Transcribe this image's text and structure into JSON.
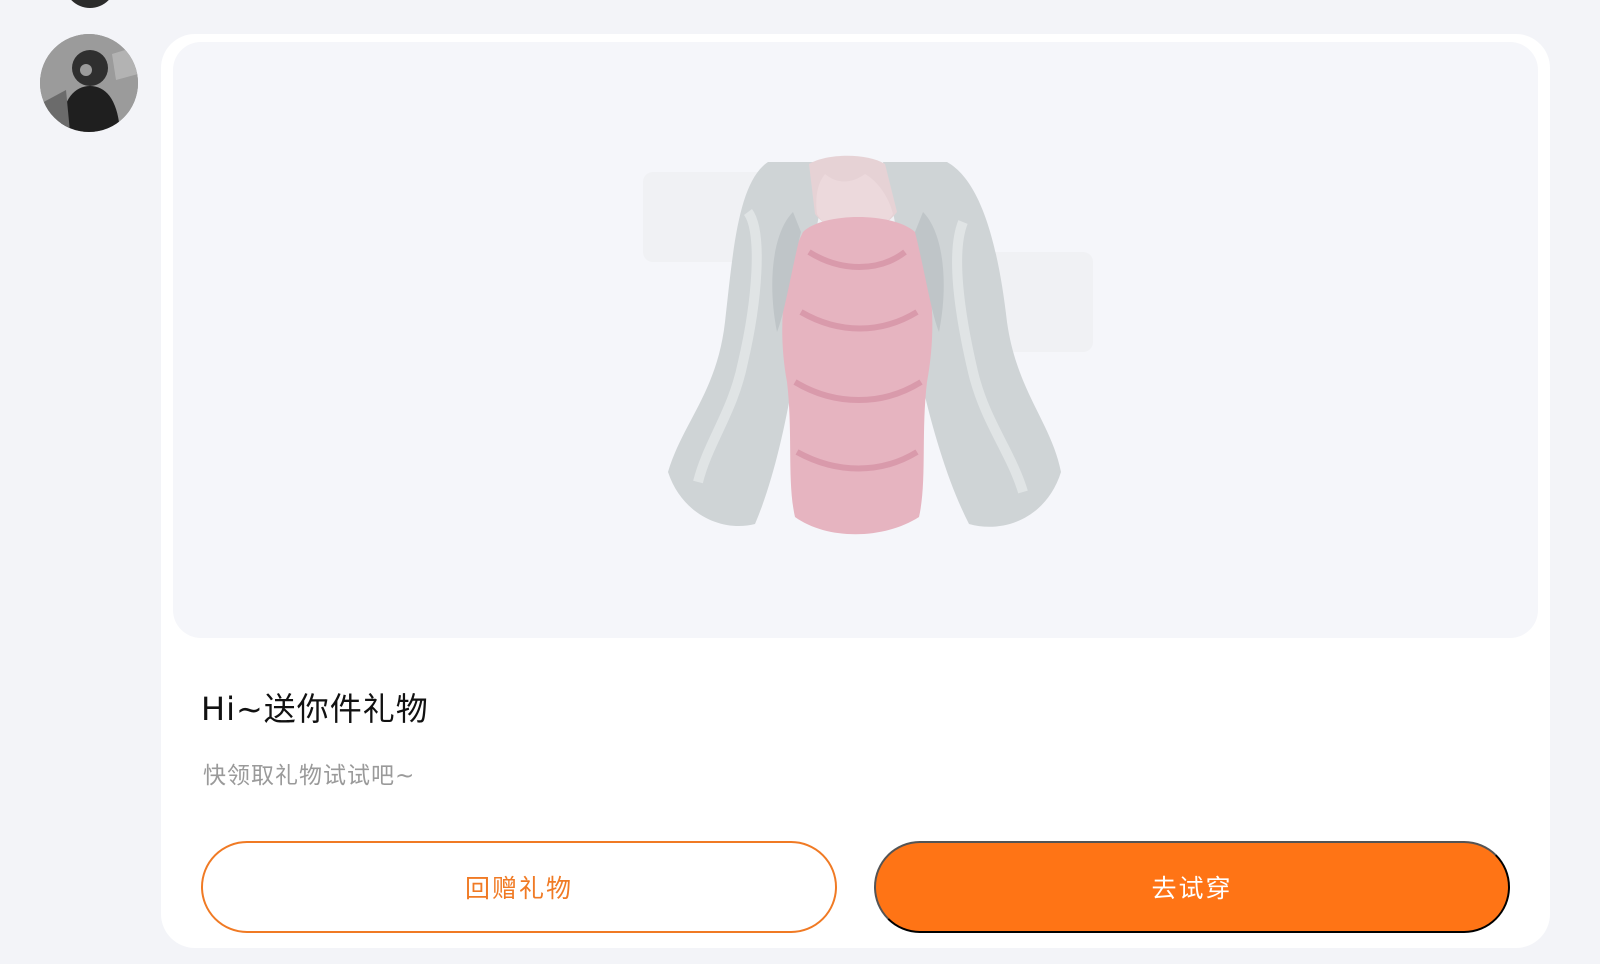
{
  "card": {
    "title": "Hi~送你件礼物",
    "subtitle": "快领取礼物试试吧~"
  },
  "buttons": {
    "return_gift": "回赠礼物",
    "try_on": "去试穿"
  },
  "colors": {
    "accent": "#FF7415",
    "background": "#F3F4F8",
    "card": "#FFFFFF"
  },
  "icons": {
    "avatar": "user-avatar",
    "gift_image": "dress-with-fur-jacket"
  }
}
